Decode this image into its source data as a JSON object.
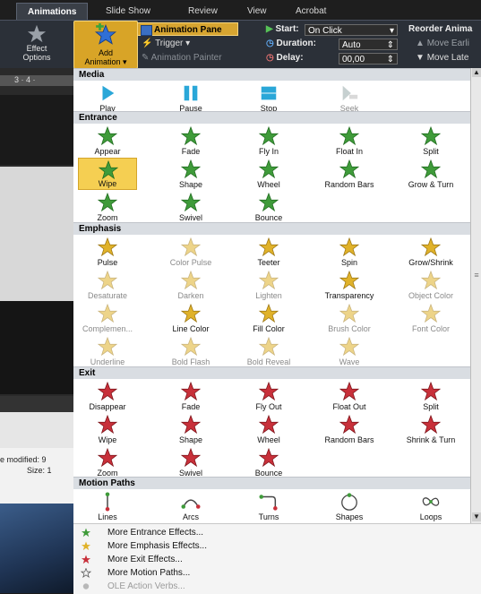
{
  "ribbon": {
    "tabs": [
      "Animations",
      "Slide Show",
      "Review",
      "View",
      "Acrobat"
    ],
    "effect_options": [
      "Effect",
      "Options"
    ],
    "add_animation": [
      "Add",
      "Animation"
    ],
    "animation_pane": "Animation Pane",
    "trigger": "Trigger",
    "animation_painter": "Animation Painter",
    "start_label": "Start:",
    "start_value": "On Click",
    "duration_label": "Duration:",
    "duration_value": "Auto",
    "delay_label": "Delay:",
    "delay_value": "00,00",
    "reorder": "Reorder Anima",
    "move_earlier": "Move Earli",
    "move_later": "Move Late"
  },
  "left": {
    "ruler": "3 · 4 ·",
    "modified": "e modified: 9",
    "size": "Size: 1"
  },
  "gallery": {
    "media": {
      "title": "Media",
      "items": [
        "Play",
        "Pause",
        "Stop",
        "Seek"
      ]
    },
    "entrance": {
      "title": "Entrance",
      "items": [
        "Appear",
        "Fade",
        "Fly In",
        "Float In",
        "Split",
        "Wipe",
        "Shape",
        "Wheel",
        "Random Bars",
        "Grow & Turn",
        "Zoom",
        "Swivel",
        "Bounce"
      ],
      "selected": "Wipe"
    },
    "emphasis": {
      "title": "Emphasis",
      "items": [
        "Pulse",
        "Color Pulse",
        "Teeter",
        "Spin",
        "Grow/Shrink",
        "Desaturate",
        "Darken",
        "Lighten",
        "Transparency",
        "Object Color",
        "Complemen...",
        "Line Color",
        "Fill Color",
        "Brush Color",
        "Font Color",
        "Underline",
        "Bold Flash",
        "Bold Reveal",
        "Wave"
      ]
    },
    "exit": {
      "title": "Exit",
      "items": [
        "Disappear",
        "Fade",
        "Fly Out",
        "Float Out",
        "Split",
        "Wipe",
        "Shape",
        "Wheel",
        "Random Bars",
        "Shrink & Turn",
        "Zoom",
        "Swivel",
        "Bounce"
      ]
    },
    "motion": {
      "title": "Motion Paths",
      "items": [
        "Lines",
        "Arcs",
        "Turns",
        "Shapes",
        "Loops"
      ]
    }
  },
  "more_menu": [
    "More Entrance Effects...",
    "More Emphasis Effects...",
    "More Exit Effects...",
    "More Motion Paths...",
    "OLE Action Verbs..."
  ],
  "colors": {
    "entrance": "#3f9b3a",
    "emphasis": "#e0a92a",
    "exit": "#c8303a",
    "media": "#2aa7d8",
    "selected": "#f5cf52"
  }
}
